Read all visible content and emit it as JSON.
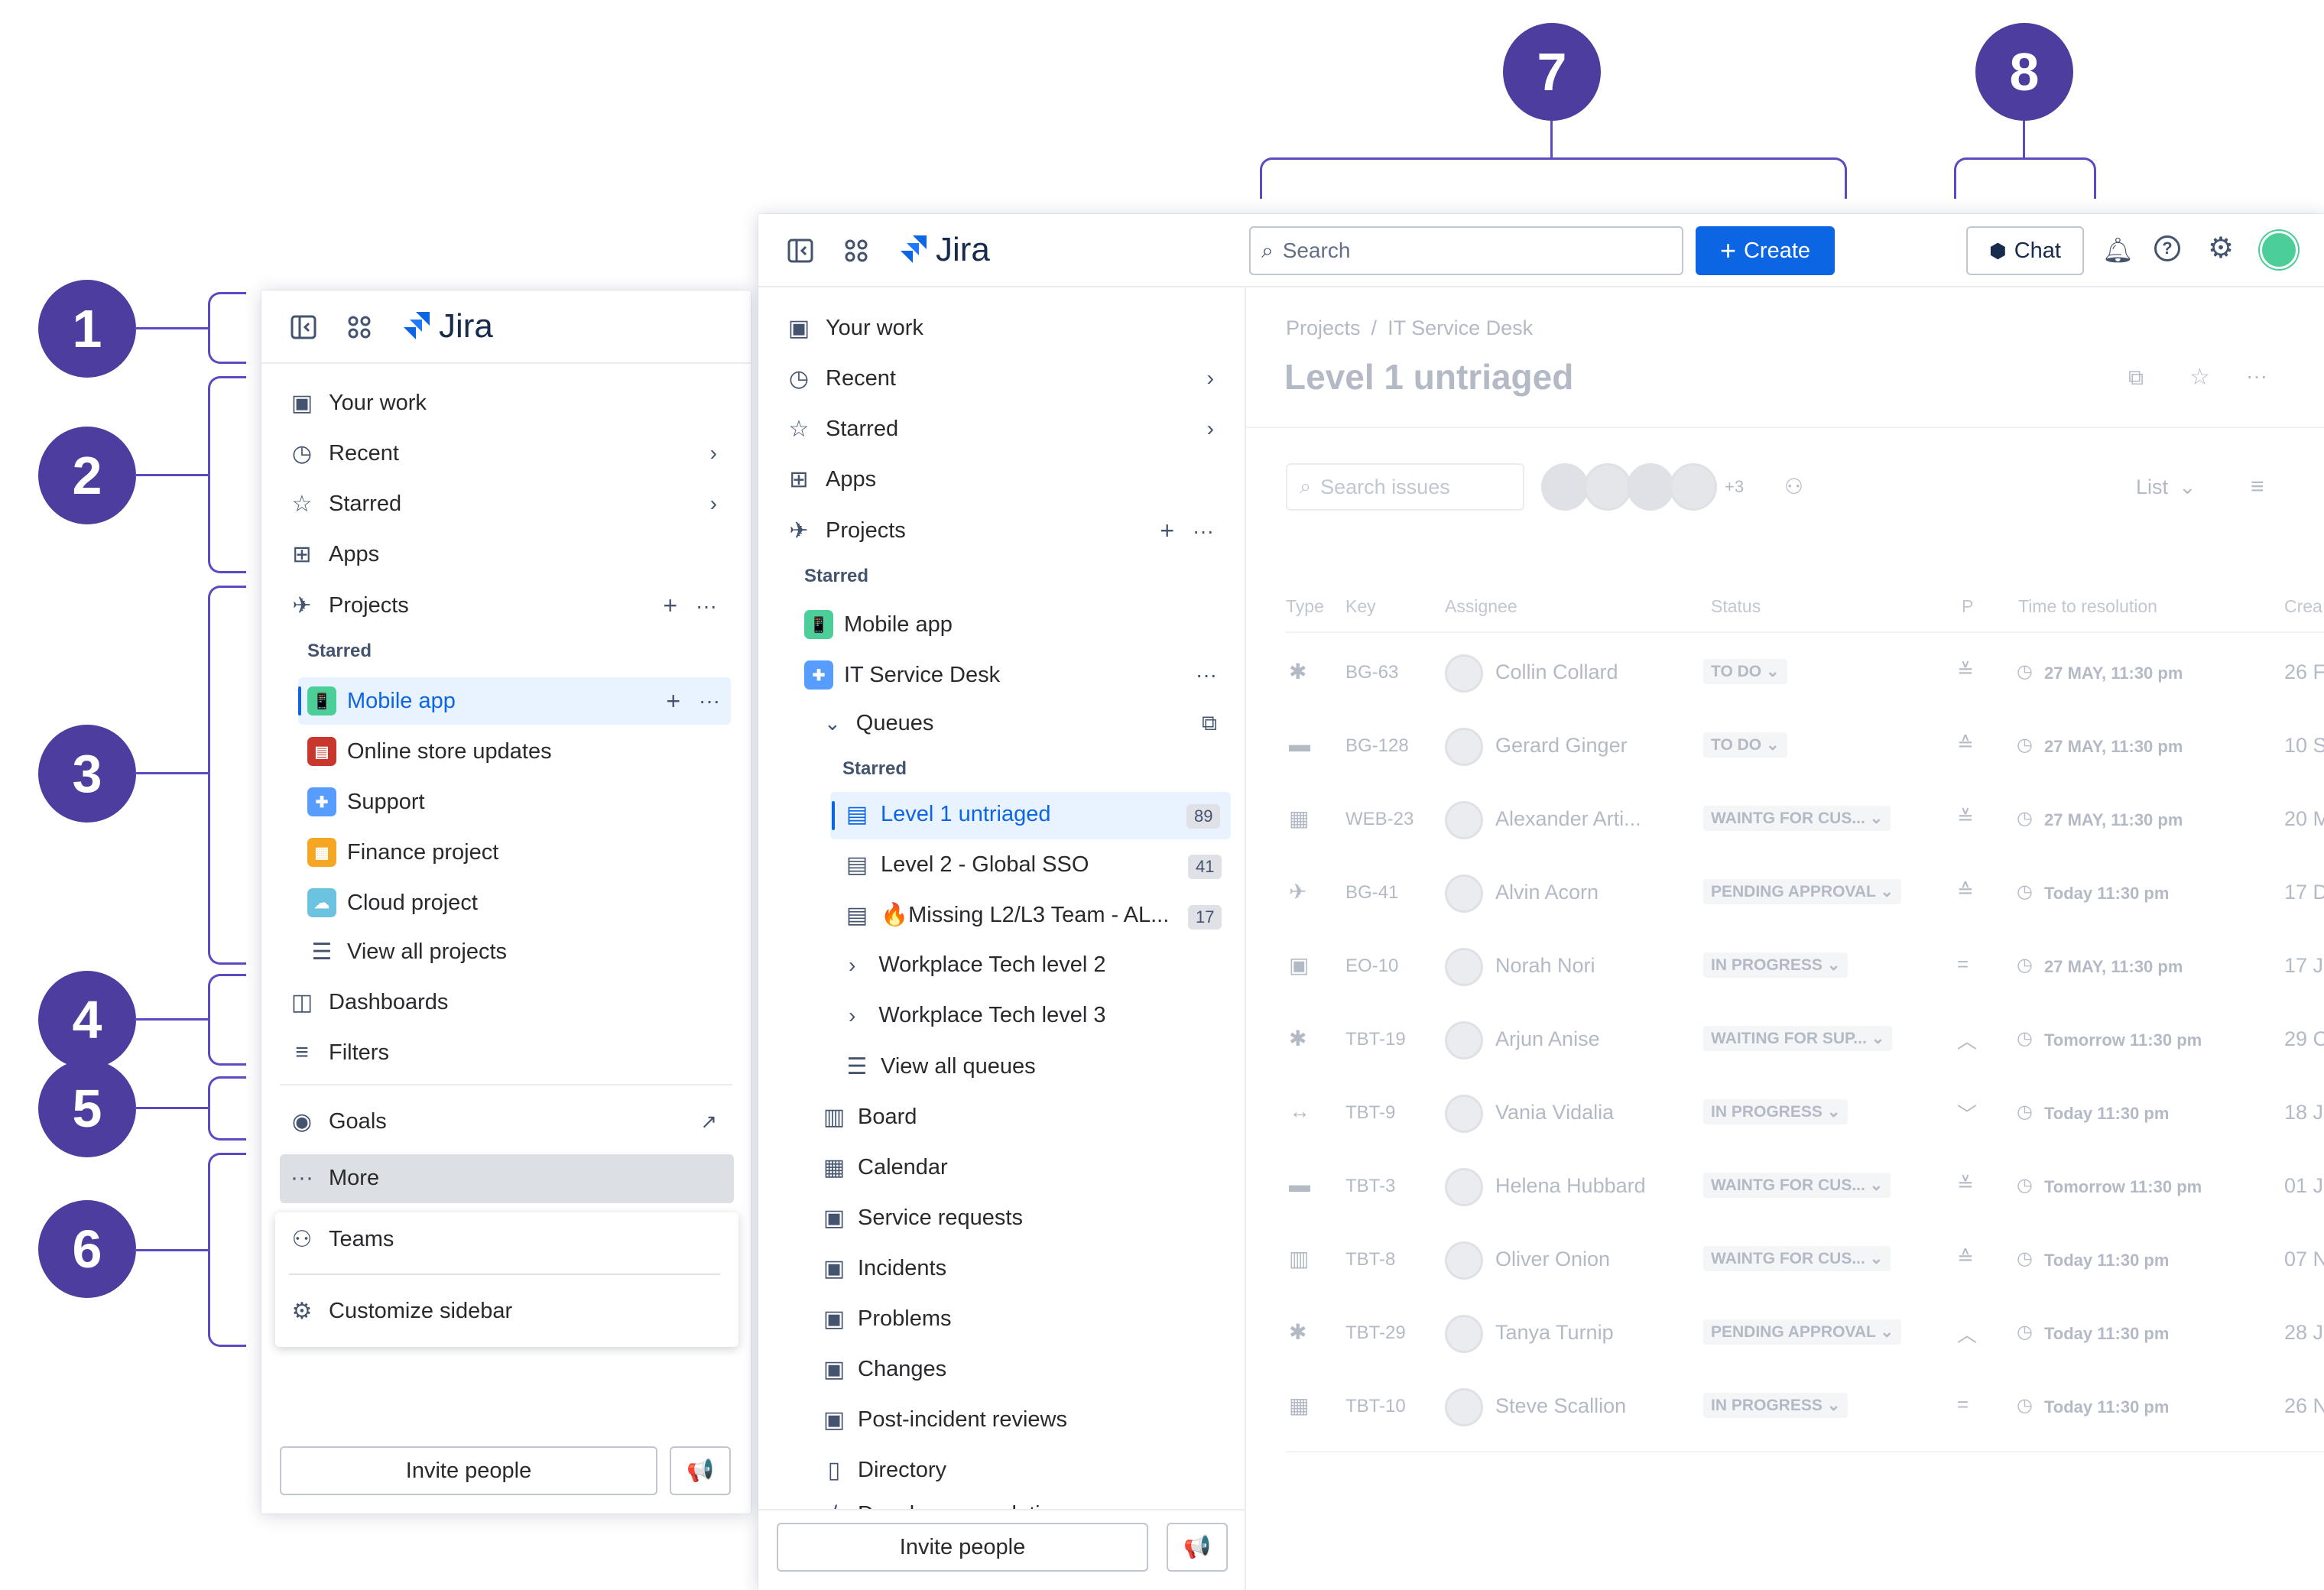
{
  "callouts": [
    "1",
    "2",
    "3",
    "4",
    "5",
    "6",
    "7",
    "8"
  ],
  "left": {
    "brand": "Jira",
    "nav": [
      "Your work",
      "Recent",
      "Starred",
      "Apps",
      "Projects"
    ],
    "starred_label": "Starred",
    "projects": [
      "Mobile app",
      "Online store updates",
      "Support",
      "Finance project",
      "Cloud project"
    ],
    "view_all": "View all projects",
    "dashboards": "Dashboards",
    "filters": "Filters",
    "goals": "Goals",
    "more": "More",
    "teams": "Teams",
    "customize": "Customize sidebar",
    "invite": "Invite people"
  },
  "main": {
    "brand": "Jira",
    "search_placeholder": "Search",
    "create": "Create",
    "chat": "Chat",
    "nav": [
      "Your work",
      "Recent",
      "Starred",
      "Apps",
      "Projects"
    ],
    "starred_label": "Starred",
    "projects": [
      "Mobile app",
      "IT Service Desk"
    ],
    "queues": "Queues",
    "queues_starred": "Starred",
    "queue_items": [
      {
        "label": "Level 1 untriaged",
        "count": "89"
      },
      {
        "label": "Level 2 - Global SSO",
        "count": "41"
      },
      {
        "label": "🔥Missing L2/L3 Team - AL...",
        "count": "17"
      }
    ],
    "groups": [
      "Workplace Tech level 2",
      "Workplace Tech level 3"
    ],
    "view_all_queues": "View all queues",
    "links": [
      "Board",
      "Calendar",
      "Service requests",
      "Incidents",
      "Problems",
      "Changes",
      "Post-incident reviews",
      "Directory",
      "Developer escalations"
    ],
    "invite": "Invite people"
  },
  "content": {
    "breadcrumb": [
      "Projects",
      "/",
      "IT Service Desk"
    ],
    "title": "Level 1 untriaged",
    "search_issues": "Search issues",
    "more_avatars": "+3",
    "view": "List",
    "headers": [
      "Type",
      "Key",
      "Assignee",
      "Status",
      "P",
      "Time to resolution",
      "Crea"
    ],
    "rows": [
      {
        "key": "BG-63",
        "assignee": "Collin Collard",
        "status": "TO DO",
        "time": "27 MAY, 11:30 pm",
        "created": "26 F"
      },
      {
        "key": "BG-128",
        "assignee": "Gerard Ginger",
        "status": "TO DO",
        "time": "27 MAY, 11:30 pm",
        "created": "10 S"
      },
      {
        "key": "WEB-23",
        "assignee": "Alexander Arti...",
        "status": "WAINTG FOR CUS...",
        "time": "27 MAY, 11:30 pm",
        "created": "20 M"
      },
      {
        "key": "BG-41",
        "assignee": "Alvin Acorn",
        "status": "PENDING APPROVAL",
        "time": "Today 11:30 pm",
        "created": "17 D"
      },
      {
        "key": "EO-10",
        "assignee": "Norah Nori",
        "status": "IN PROGRESS",
        "time": "27 MAY, 11:30 pm",
        "created": "17 J"
      },
      {
        "key": "TBT-19",
        "assignee": "Arjun Anise",
        "status": "WAITING FOR SUP...",
        "time": "Tomorrow 11:30 pm",
        "created": "29 C"
      },
      {
        "key": "TBT-9",
        "assignee": "Vania Vidalia",
        "status": "IN PROGRESS",
        "time": "Today 11:30 pm",
        "created": "18 J"
      },
      {
        "key": "TBT-3",
        "assignee": "Helena Hubbard",
        "status": "WAINTG FOR CUS...",
        "time": "Tomorrow 11:30 pm",
        "created": "01 J"
      },
      {
        "key": "TBT-8",
        "assignee": "Oliver Onion",
        "status": "WAINTG FOR CUS...",
        "time": "Today 11:30 pm",
        "created": "07 N"
      },
      {
        "key": "TBT-29",
        "assignee": "Tanya Turnip",
        "status": "PENDING APPROVAL",
        "time": "Today 11:30 pm",
        "created": "28 J"
      },
      {
        "key": "TBT-10",
        "assignee": "Steve Scallion",
        "status": "IN PROGRESS",
        "time": "Today 11:30 pm",
        "created": "26 N"
      }
    ]
  },
  "colors": {
    "accent": "#0c66e4",
    "callout": "#4c3d9e",
    "selected_bg": "#e9f2ff"
  }
}
